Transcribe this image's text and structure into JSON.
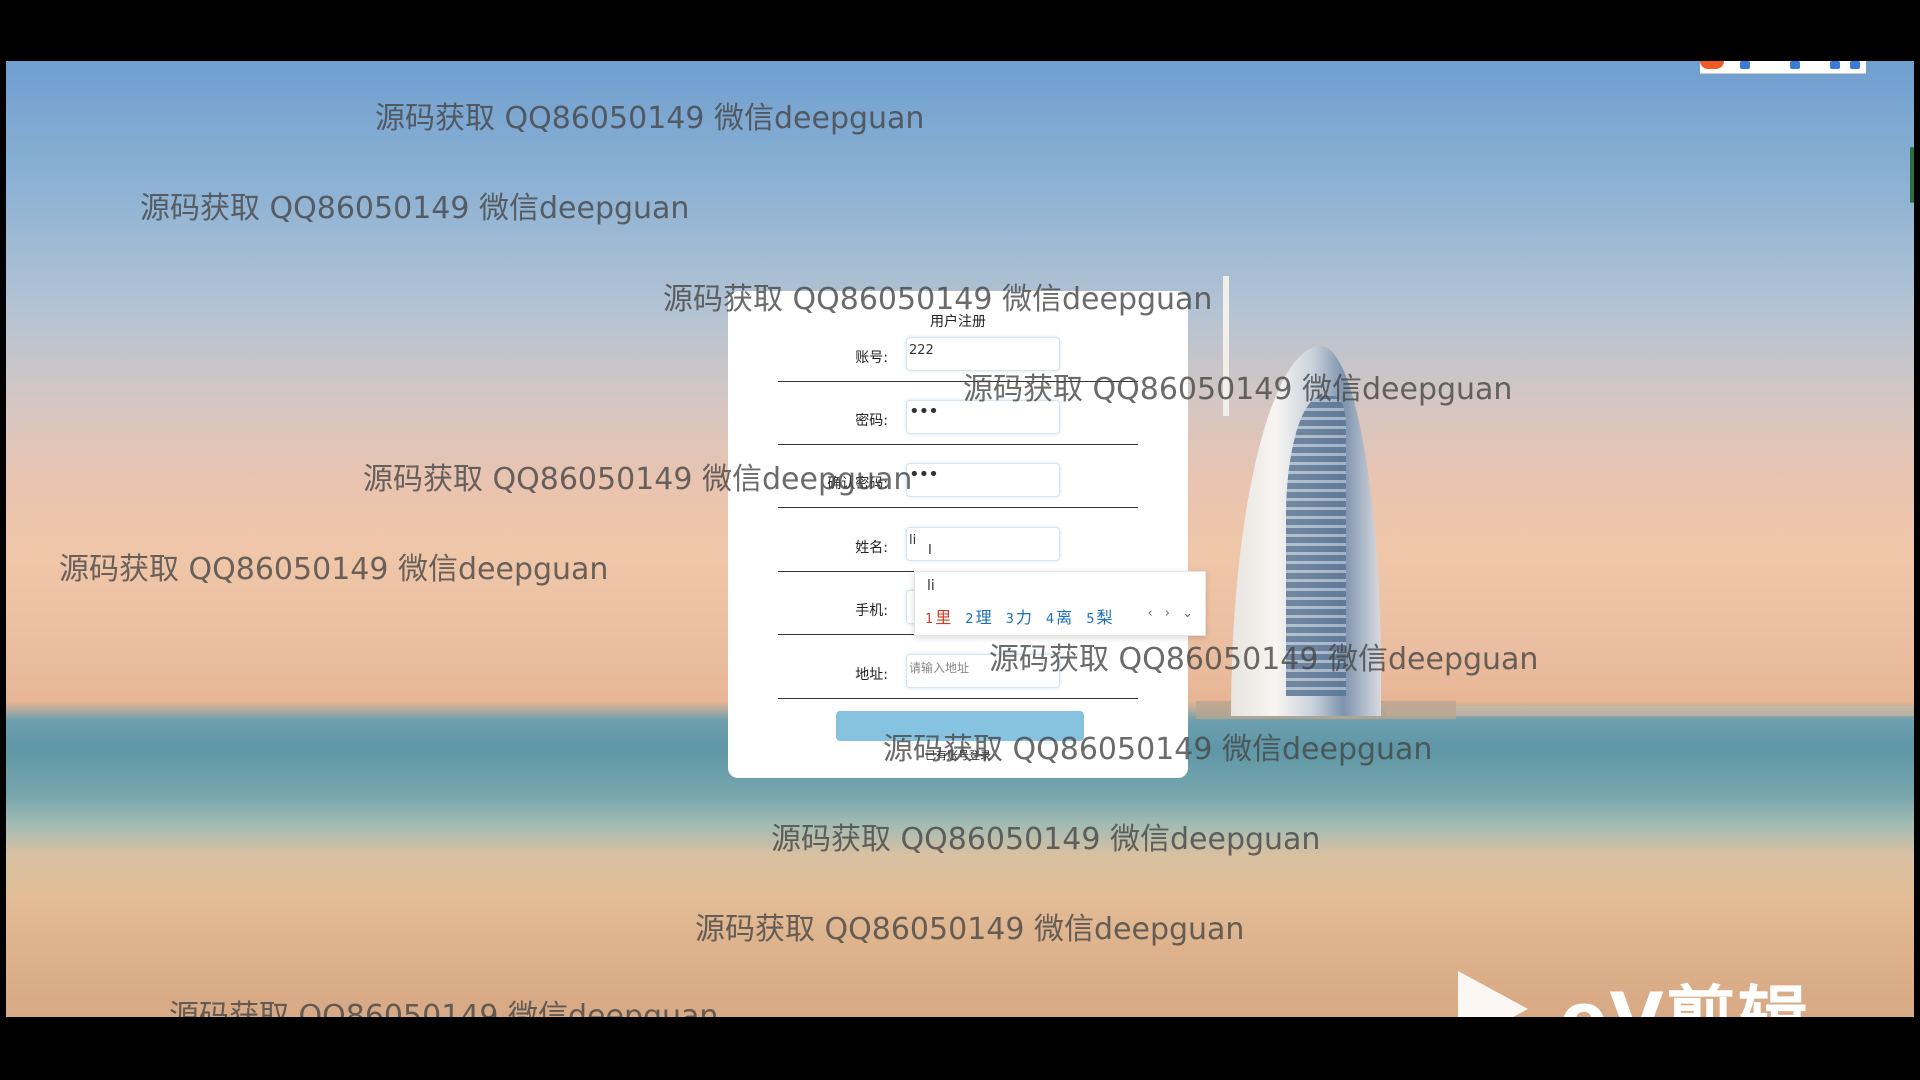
{
  "form": {
    "title": "用户注册",
    "fields": [
      {
        "label": "账号:",
        "value": "222",
        "placeholder": ""
      },
      {
        "label": "密码:",
        "value": "•••",
        "placeholder": ""
      },
      {
        "label": "确认密码:",
        "value": "•••",
        "placeholder": ""
      },
      {
        "label": "姓名:",
        "value": "li",
        "placeholder": ""
      },
      {
        "label": "手机:",
        "value": "",
        "placeholder": ""
      },
      {
        "label": "地址:",
        "value": "",
        "placeholder": "请输入地址"
      }
    ],
    "login_link": "已有账号登录"
  },
  "ime": {
    "composing": "li",
    "candidates": [
      {
        "n": "1",
        "text": "里"
      },
      {
        "n": "2",
        "text": "理"
      },
      {
        "n": "3",
        "text": "力"
      },
      {
        "n": "4",
        "text": "离"
      },
      {
        "n": "5",
        "text": "梨"
      }
    ],
    "nav": "‹ › ⌄"
  },
  "watermark": "源码获取 QQ86050149 微信deepguan",
  "ev_logo": "eV剪辑",
  "colors": {
    "submit": "#86c3e0",
    "ime_highlight": "#d13b27",
    "ime_candidate": "#1d6fb5"
  }
}
